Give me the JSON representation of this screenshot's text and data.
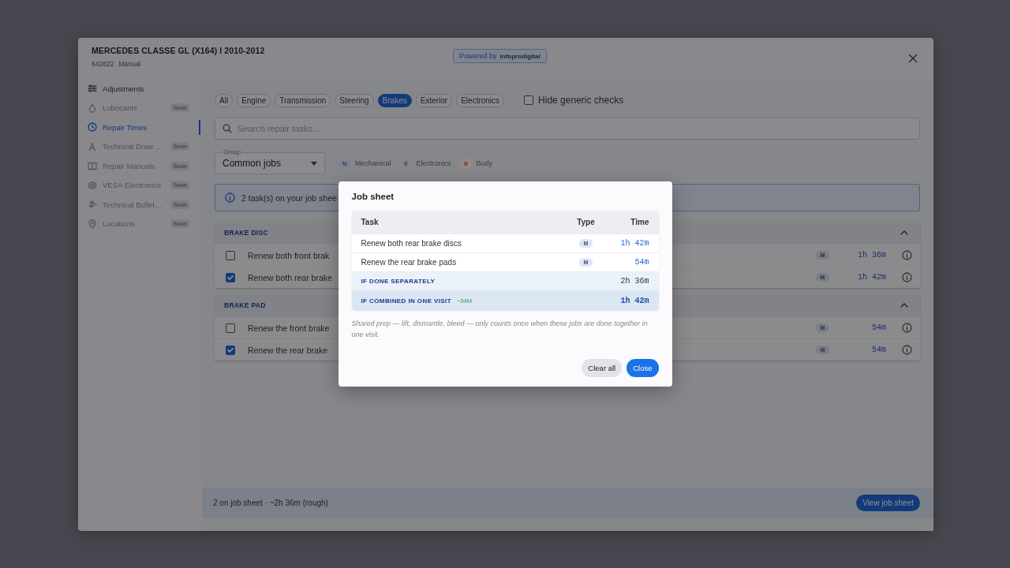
{
  "window": {
    "title": "MERCEDES CLASSE GL (X164) I 2010-2012",
    "code": "642822",
    "transmission": "Manual",
    "powered_by": "Powered by",
    "brand": "infoprodigital"
  },
  "sidebar": {
    "items": [
      {
        "label": "Adjustments",
        "selected": false,
        "disabled": false
      },
      {
        "label": "Lubricants",
        "selected": false,
        "disabled": true,
        "badge": "Soon"
      },
      {
        "label": "Repair Times",
        "selected": true,
        "disabled": false
      },
      {
        "label": "Technical Draw…",
        "selected": false,
        "disabled": true,
        "badge": "Soon"
      },
      {
        "label": "Repair Manuals",
        "selected": false,
        "disabled": true,
        "badge": "Soon"
      },
      {
        "label": "VESA Electronics",
        "selected": false,
        "disabled": true,
        "badge": "Soon"
      },
      {
        "label": "Technical Bullet…",
        "selected": false,
        "disabled": true,
        "badge": "Soon"
      },
      {
        "label": "Locations",
        "selected": false,
        "disabled": true,
        "badge": "Soon"
      }
    ]
  },
  "filters": {
    "chips": [
      {
        "label": "All",
        "selected": false
      },
      {
        "label": "Engine",
        "selected": false
      },
      {
        "label": "Transmission",
        "selected": false
      },
      {
        "label": "Steering",
        "selected": false
      },
      {
        "label": "Brakes",
        "selected": true
      },
      {
        "label": "Exterior",
        "selected": false
      },
      {
        "label": "Electronics",
        "selected": false
      }
    ],
    "hide_generic": {
      "label": "Hide generic checks",
      "checked": false
    }
  },
  "search": {
    "placeholder": "Search repair tasks..."
  },
  "group": {
    "label": "Group",
    "value": "Common jobs"
  },
  "legend": [
    {
      "letter": "M",
      "label": "Mechanical",
      "color": "#7b8396"
    },
    {
      "letter": "E",
      "label": "Electronics",
      "color": "#86868c"
    },
    {
      "letter": "B",
      "label": "Body",
      "color": "#9a8780"
    }
  ],
  "banner": {
    "text": "2 task(s) on your job shee"
  },
  "sections": [
    {
      "title": "BRAKE DISC",
      "expanded": true,
      "rows": [
        {
          "task": "Renew both front brak",
          "checked": false,
          "type": "M",
          "time": "1h 36m"
        },
        {
          "task": "Renew both rear brake",
          "checked": true,
          "type": "M",
          "time": "1h 42m"
        }
      ]
    },
    {
      "title": "BRAKE PAD",
      "expanded": true,
      "rows": [
        {
          "task": "Renew the front brake",
          "checked": false,
          "type": "M",
          "time": "54m"
        },
        {
          "task": "Renew the rear brake",
          "checked": true,
          "type": "M",
          "time": "54m"
        }
      ]
    }
  ],
  "footer": {
    "summary": "2 on job sheet · ~2h 36m (rough)",
    "button": "View job sheet"
  },
  "modal": {
    "title": "Job sheet",
    "columns": [
      "Task",
      "Type",
      "Time"
    ],
    "rows": [
      {
        "task": "Renew both rear brake discs",
        "type": "M",
        "time": "1h 42m"
      },
      {
        "task": "Renew the rear brake pads",
        "type": "M",
        "time": "54m"
      }
    ],
    "separately": {
      "label": "IF DONE SEPARATELY",
      "time": "2h 36m"
    },
    "combined": {
      "label": "IF COMBINED IN ONE VISIT",
      "saving": "−54M",
      "time": "1h 42m"
    },
    "note": "Shared prep — lift, dismantle, bleed — only counts once when these jobs are done together in one visit.",
    "buttons": [
      {
        "label": "Clear all",
        "kind": "secondary"
      },
      {
        "label": "Close",
        "kind": "primary"
      }
    ]
  }
}
